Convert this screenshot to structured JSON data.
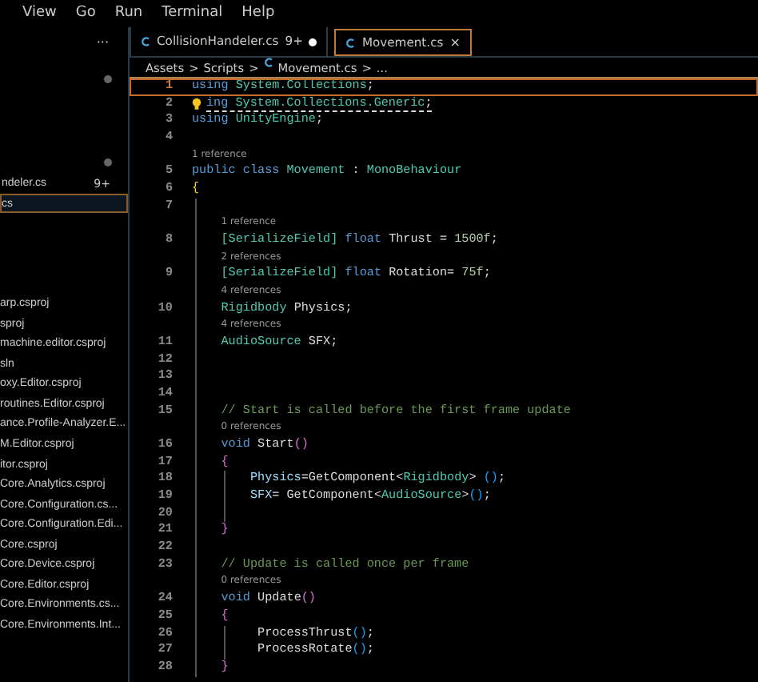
{
  "menu": [
    "View",
    "Go",
    "Run",
    "Terminal",
    "Help"
  ],
  "sidebar": {
    "more": "···",
    "open_editors": [
      {
        "label": "ndeler.cs",
        "badge": "9+",
        "selected": false
      },
      {
        "label": "cs",
        "selected": true
      }
    ],
    "files": [
      "arp.csproj",
      "sproj",
      "machine.editor.csproj",
      "sln",
      "oxy.Editor.csproj",
      "routines.Editor.csproj",
      "ance.Profile-Analyzer.E...",
      "M.Editor.csproj",
      "itor.csproj",
      "Core.Analytics.csproj",
      "Core.Configuration.cs...",
      "Core.Configuration.Edi...",
      "Core.csproj",
      "Core.Device.csproj",
      "Core.Editor.csproj",
      "Core.Environments.cs...",
      "Core.Environments.Int..."
    ]
  },
  "tabs": [
    {
      "label": "CollisionHandeler.cs",
      "badge": "9+",
      "selected": false,
      "dirty": true
    },
    {
      "label": "Movement.cs",
      "selected": true,
      "dirty": false,
      "close": "×"
    }
  ],
  "breadcrumb": [
    "Assets",
    "Scripts",
    "Movement.cs",
    "..."
  ],
  "breadcrumb_separator": ">",
  "code": [
    {
      "kind": "code",
      "number": "1",
      "current": true,
      "tokens": [
        {
          "kind": "keyword",
          "text": "using "
        },
        {
          "kind": "type",
          "text": "System.Collections"
        },
        {
          "kind": "plain",
          "text": ";"
        }
      ]
    },
    {
      "kind": "code",
      "number": "2",
      "current": false,
      "warning": true,
      "tokens": [
        {
          "kind": "keyword",
          "text": "ing "
        },
        {
          "kind": "type",
          "text": "System.Collections.Generic"
        },
        {
          "kind": "plain",
          "text": ";"
        }
      ]
    },
    {
      "kind": "code",
      "number": "3",
      "current": false,
      "tokens": [
        {
          "kind": "keyword",
          "text": "using "
        },
        {
          "kind": "type",
          "text": "UnityEngine"
        },
        {
          "kind": "plain",
          "text": ";"
        }
      ]
    },
    {
      "kind": "code",
      "number": "4",
      "current": false
    },
    {
      "kind": "lens",
      "text": "1 reference"
    },
    {
      "kind": "code",
      "number": "5",
      "current": false,
      "tokens": [
        {
          "kind": "keyword",
          "text": "public class "
        },
        {
          "kind": "type",
          "text": "Movement"
        },
        {
          "kind": "plain",
          "text": " : "
        },
        {
          "kind": "type",
          "text": "MonoBehaviour"
        }
      ]
    },
    {
      "kind": "code",
      "number": "6",
      "current": false,
      "tokens": [
        {
          "kind": "bracket1",
          "text": "{"
        }
      ],
      "children": [
        {
          "kind": "code",
          "number": "7",
          "current": false
        },
        {
          "kind": "lens",
          "text": "1 reference"
        },
        {
          "kind": "code",
          "number": "8",
          "current": false,
          "tokens": [
            {
              "kind": "type",
              "text": "[SerializeField] "
            },
            {
              "kind": "keyword",
              "text": "float "
            },
            {
              "kind": "name",
              "text": "Thrust = "
            },
            {
              "kind": "number",
              "text": "1500f"
            },
            {
              "kind": "plain",
              "text": ";"
            }
          ]
        },
        {
          "kind": "lens",
          "text": "2 references"
        },
        {
          "kind": "code",
          "number": "9",
          "current": false,
          "tokens": [
            {
              "kind": "type",
              "text": "[SerializeField] "
            },
            {
              "kind": "keyword",
              "text": "float "
            },
            {
              "kind": "name",
              "text": "Rotation= "
            },
            {
              "kind": "number",
              "text": "75f"
            },
            {
              "kind": "plain",
              "text": ";"
            }
          ]
        },
        {
          "kind": "lens",
          "text": "4 references"
        },
        {
          "kind": "code",
          "number": "10",
          "current": false,
          "tokens": [
            {
              "kind": "type",
              "text": "Rigidbody "
            },
            {
              "kind": "name",
              "text": "Physics;"
            }
          ]
        },
        {
          "kind": "lens",
          "text": "4 references"
        },
        {
          "kind": "code",
          "number": "11",
          "current": false,
          "tokens": [
            {
              "kind": "type",
              "text": "AudioSource "
            },
            {
              "kind": "name",
              "text": "SFX;"
            }
          ]
        },
        {
          "kind": "code",
          "number": "12",
          "current": false
        },
        {
          "kind": "code",
          "number": "13",
          "current": false
        },
        {
          "kind": "code",
          "number": "14",
          "current": false
        },
        {
          "kind": "code",
          "number": "15",
          "current": false,
          "tokens": [
            {
              "kind": "comment",
              "text": "// Start is called before the first frame update"
            }
          ]
        },
        {
          "kind": "lens",
          "text": "0 references"
        },
        {
          "kind": "code",
          "number": "16",
          "current": false,
          "tokens": [
            {
              "kind": "keyword",
              "text": "void "
            },
            {
              "kind": "name",
              "text": "Start"
            },
            {
              "kind": "bracket2",
              "text": "()"
            }
          ]
        },
        {
          "kind": "code",
          "number": "17",
          "current": false,
          "tokens": [
            {
              "kind": "bracket2",
              "text": "{"
            }
          ],
          "children": [
            {
              "kind": "code",
              "number": "18",
              "current": false,
              "tokens": [
                {
                  "kind": "var",
                  "text": "Physics"
                },
                {
                  "kind": "plain",
                  "text": "=GetComponent<"
                },
                {
                  "kind": "type",
                  "text": "Rigidbody"
                },
                {
                  "kind": "plain",
                  "text": "> "
                },
                {
                  "kind": "bracket3",
                  "text": "()"
                },
                {
                  "kind": "plain",
                  "text": ";"
                }
              ]
            },
            {
              "kind": "code",
              "number": "19",
              "current": false,
              "tokens": [
                {
                  "kind": "var",
                  "text": "SFX"
                },
                {
                  "kind": "plain",
                  "text": "= GetComponent<"
                },
                {
                  "kind": "type",
                  "text": "AudioSource"
                },
                {
                  "kind": "plain",
                  "text": ">"
                },
                {
                  "kind": "bracket3",
                  "text": "()"
                },
                {
                  "kind": "plain",
                  "text": ";"
                }
              ]
            },
            {
              "kind": "code",
              "number": "20",
              "current": false
            }
          ]
        },
        {
          "kind": "code",
          "number": "21",
          "current": false,
          "tokens": [
            {
              "kind": "bracket2",
              "text": "}"
            }
          ]
        },
        {
          "kind": "code",
          "number": "22",
          "current": false
        },
        {
          "kind": "code",
          "number": "23",
          "current": false,
          "tokens": [
            {
              "kind": "comment",
              "text": "// Update is called once per frame"
            }
          ]
        },
        {
          "kind": "lens",
          "text": "0 references"
        },
        {
          "kind": "code",
          "number": "24",
          "current": false,
          "tokens": [
            {
              "kind": "keyword",
              "text": "void "
            },
            {
              "kind": "name",
              "text": "Update"
            },
            {
              "kind": "bracket2",
              "text": "()"
            }
          ]
        },
        {
          "kind": "code",
          "number": "25",
          "current": false,
          "tokens": [
            {
              "kind": "bracket2",
              "text": "{"
            }
          ],
          "children": [
            {
              "kind": "code",
              "number": "26",
              "current": false,
              "tokens": [
                {
                  "kind": "plain",
                  "text": " ProcessThrust"
                },
                {
                  "kind": "bracket3",
                  "text": "()"
                },
                {
                  "kind": "plain",
                  "text": ";"
                }
              ]
            },
            {
              "kind": "code",
              "number": "27",
              "current": false,
              "tokens": [
                {
                  "kind": "plain",
                  "text": " ProcessRotate"
                },
                {
                  "kind": "bracket3",
                  "text": "()"
                },
                {
                  "kind": "plain",
                  "text": ";"
                }
              ]
            }
          ]
        },
        {
          "kind": "code",
          "number": "28",
          "current": false,
          "tokens": [
            {
              "kind": "bracket2",
              "text": "}"
            }
          ]
        }
      ]
    }
  ]
}
